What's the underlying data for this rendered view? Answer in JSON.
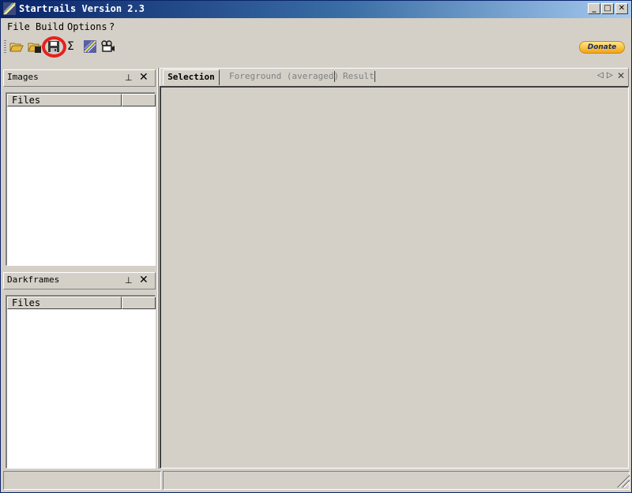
{
  "window": {
    "title": "Startrails Version 2.3",
    "caption_buttons": {
      "minimize": "_",
      "maximize": "□",
      "close": "✕"
    }
  },
  "menu": {
    "items": [
      "File",
      "Build",
      "Options",
      "?"
    ]
  },
  "toolbar": {
    "icons": [
      "open-folder-icon",
      "open-dark-folder-icon",
      "save-disk-icon",
      "sum-sigma-icon",
      "star-image-icon",
      "video-camera-icon"
    ],
    "sigma_glyph": "Σ",
    "highlight_color": "#e8201c",
    "donate_label": "Donate"
  },
  "panels": {
    "images": {
      "title": "Images",
      "column": "Files"
    },
    "darkframes": {
      "title": "Darkframes",
      "column": "Files"
    }
  },
  "tabs": [
    {
      "label": "Selection",
      "active": true
    },
    {
      "label": "Foreground (averaged)",
      "active": false
    },
    {
      "label": "Result",
      "active": false
    }
  ],
  "tab_nav": {
    "prev": "◁",
    "next": "▷",
    "close": "✕"
  },
  "pin_glyph": "⊥",
  "close_glyph": "✕"
}
